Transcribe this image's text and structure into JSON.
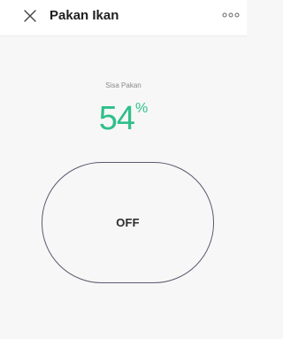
{
  "header": {
    "title": "Pakan Ikan",
    "close_icon": "close-icon",
    "more_icon": "more-dots-icon"
  },
  "feeder": {
    "label": "Sisa Pakan",
    "value": "54",
    "unit": "%",
    "value_color": "#2fbf8a",
    "power_label": "OFF"
  }
}
